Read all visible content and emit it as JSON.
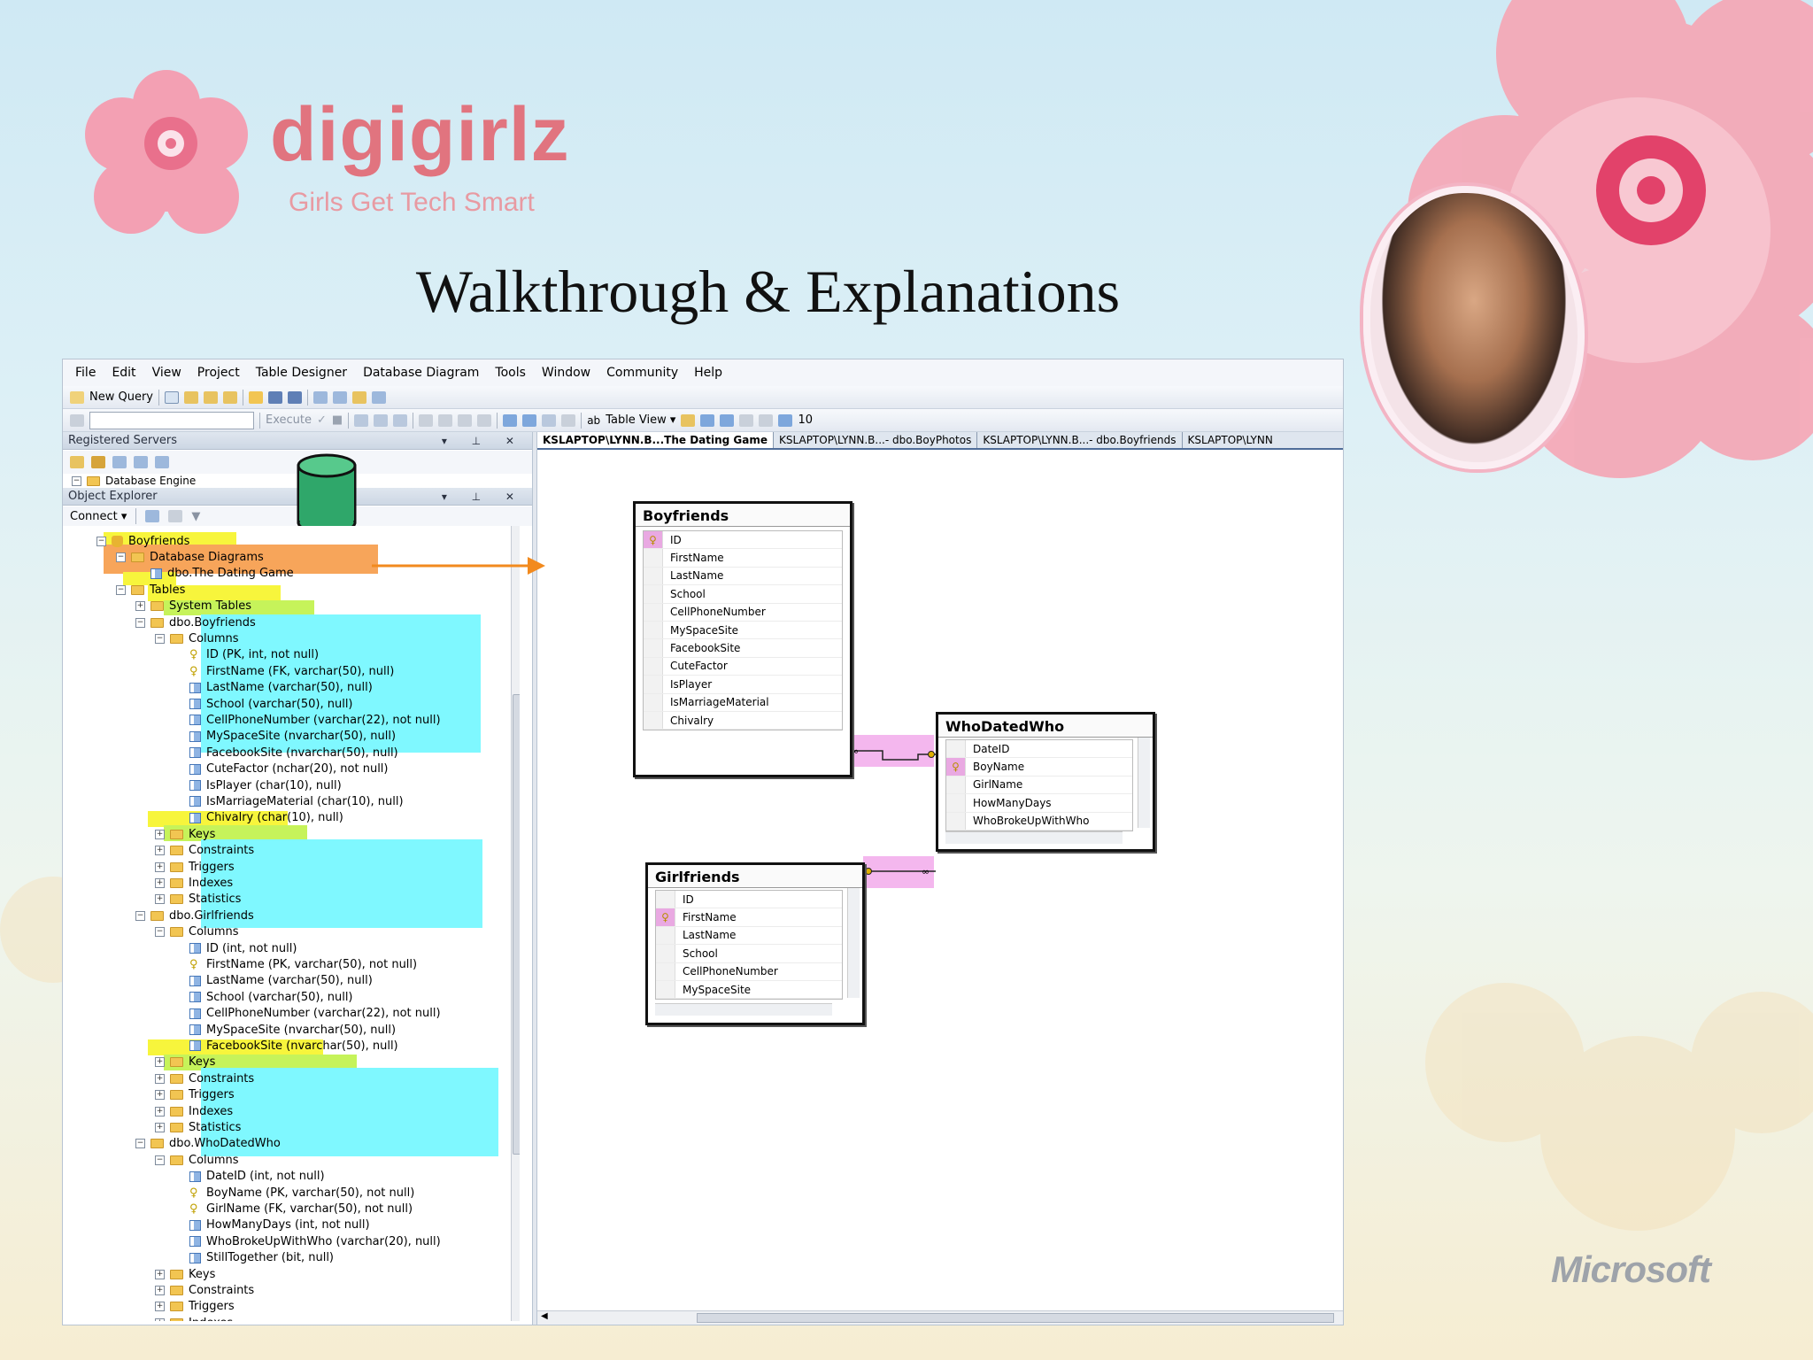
{
  "slide": {
    "brand_name": "digigirlz",
    "brand_tagline": "Girls Get Tech Smart",
    "title": "Walkthrough & Explanations",
    "footer_logo": "Microsoft"
  },
  "menu": [
    "File",
    "Edit",
    "View",
    "Project",
    "Table Designer",
    "Database Diagram",
    "Tools",
    "Window",
    "Community",
    "Help"
  ],
  "toolbar": {
    "new_query": "New Query",
    "execute": "Execute",
    "table_view": "Table View ▾",
    "zoom": "10"
  },
  "registered_servers": {
    "header": "Registered Servers",
    "item": "Database Engine"
  },
  "object_explorer": {
    "header": "Object Explorer",
    "connect": "Connect ▾",
    "nodes": [
      {
        "text": "Boyfriends",
        "icon": "database-icon",
        "exp": "−"
      },
      {
        "text": "Database Diagrams",
        "icon": "folder-icon",
        "exp": "−"
      },
      {
        "text": "dbo.The Dating Game",
        "icon": "diagram-icon",
        "exp": ""
      },
      {
        "text": "Tables",
        "icon": "folder-icon",
        "exp": "−"
      },
      {
        "text": "System Tables",
        "icon": "folder-icon",
        "exp": "+"
      },
      {
        "text": "dbo.Boyfriends",
        "icon": "table-icon",
        "exp": "−"
      },
      {
        "text": "Columns",
        "icon": "folder-icon",
        "exp": "−"
      },
      {
        "text": "ID (PK, int, not null)",
        "icon": "key-icon",
        "exp": ""
      },
      {
        "text": "FirstName (FK, varchar(50), null)",
        "icon": "key-icon",
        "exp": ""
      },
      {
        "text": "LastName (varchar(50), null)",
        "icon": "column-icon",
        "exp": ""
      },
      {
        "text": "School (varchar(50), null)",
        "icon": "column-icon",
        "exp": ""
      },
      {
        "text": "CellPhoneNumber (varchar(22), not null)",
        "icon": "column-icon",
        "exp": ""
      },
      {
        "text": "MySpaceSite (nvarchar(50), null)",
        "icon": "column-icon",
        "exp": ""
      },
      {
        "text": "FacebookSite (nvarchar(50), null)",
        "icon": "column-icon",
        "exp": ""
      },
      {
        "text": "CuteFactor (nchar(20), not null)",
        "icon": "column-icon",
        "exp": ""
      },
      {
        "text": "IsPlayer (char(10), null)",
        "icon": "column-icon",
        "exp": ""
      },
      {
        "text": "IsMarriageMaterial (char(10), null)",
        "icon": "column-icon",
        "exp": ""
      },
      {
        "text": "Chivalry (char(10), null)",
        "icon": "column-icon",
        "exp": ""
      },
      {
        "text": "Keys",
        "icon": "folder-icon",
        "exp": "+"
      },
      {
        "text": "Constraints",
        "icon": "folder-icon",
        "exp": "+"
      },
      {
        "text": "Triggers",
        "icon": "folder-icon",
        "exp": "+"
      },
      {
        "text": "Indexes",
        "icon": "folder-icon",
        "exp": "+"
      },
      {
        "text": "Statistics",
        "icon": "folder-icon",
        "exp": "+"
      },
      {
        "text": "dbo.Girlfriends",
        "icon": "table-icon",
        "exp": "−"
      },
      {
        "text": "Columns",
        "icon": "folder-icon",
        "exp": "−"
      },
      {
        "text": "ID (int, not null)",
        "icon": "column-icon",
        "exp": ""
      },
      {
        "text": "FirstName (PK, varchar(50), not null)",
        "icon": "key-icon",
        "exp": ""
      },
      {
        "text": "LastName (varchar(50), null)",
        "icon": "column-icon",
        "exp": ""
      },
      {
        "text": "School (varchar(50), null)",
        "icon": "column-icon",
        "exp": ""
      },
      {
        "text": "CellPhoneNumber (varchar(22), not null)",
        "icon": "column-icon",
        "exp": ""
      },
      {
        "text": "MySpaceSite (nvarchar(50), null)",
        "icon": "column-icon",
        "exp": ""
      },
      {
        "text": "FacebookSite (nvarchar(50), null)",
        "icon": "column-icon",
        "exp": ""
      },
      {
        "text": "Keys",
        "icon": "folder-icon",
        "exp": "+"
      },
      {
        "text": "Constraints",
        "icon": "folder-icon",
        "exp": "+"
      },
      {
        "text": "Triggers",
        "icon": "folder-icon",
        "exp": "+"
      },
      {
        "text": "Indexes",
        "icon": "folder-icon",
        "exp": "+"
      },
      {
        "text": "Statistics",
        "icon": "folder-icon",
        "exp": "+"
      },
      {
        "text": "dbo.WhoDatedWho",
        "icon": "table-icon",
        "exp": "−"
      },
      {
        "text": "Columns",
        "icon": "folder-icon",
        "exp": "−"
      },
      {
        "text": "DateID (int, not null)",
        "icon": "column-icon",
        "exp": ""
      },
      {
        "text": "BoyName (PK, varchar(50), not null)",
        "icon": "key-icon",
        "exp": ""
      },
      {
        "text": "GirlName (FK, varchar(50), not null)",
        "icon": "key-icon",
        "exp": ""
      },
      {
        "text": "HowManyDays (int, not null)",
        "icon": "column-icon",
        "exp": ""
      },
      {
        "text": "WhoBrokeUpWithWho (varchar(20), null)",
        "icon": "column-icon",
        "exp": ""
      },
      {
        "text": "StillTogether (bit, null)",
        "icon": "column-icon",
        "exp": ""
      },
      {
        "text": "Keys",
        "icon": "folder-icon",
        "exp": "+"
      },
      {
        "text": "Constraints",
        "icon": "folder-icon",
        "exp": "+"
      },
      {
        "text": "Triggers",
        "icon": "folder-icon",
        "exp": "+"
      },
      {
        "text": "Indexes",
        "icon": "folder-icon",
        "exp": "+"
      }
    ]
  },
  "doc_tabs": [
    "KSLAPTOP\\LYNN.B...The Dating Game",
    "KSLAPTOP\\LYNN.B...- dbo.BoyPhotos",
    "KSLAPTOP\\LYNN.B...- dbo.Boyfriends",
    "KSLAPTOP\\LYNN"
  ],
  "diagram": {
    "boyfriends": {
      "title": "Boyfriends",
      "columns": [
        "ID",
        "FirstName",
        "LastName",
        "School",
        "CellPhoneNumber",
        "MySpaceSite",
        "FacebookSite",
        "CuteFactor",
        "IsPlayer",
        "IsMarriageMaterial",
        "Chivalry"
      ]
    },
    "whodatedwho": {
      "title": "WhoDatedWho",
      "columns": [
        "DateID",
        "BoyName",
        "GirlName",
        "HowManyDays",
        "WhoBrokeUpWithWho"
      ]
    },
    "girlfriends": {
      "title": "Girlfriends",
      "columns": [
        "ID",
        "FirstName",
        "LastName",
        "School",
        "CellPhoneNumber",
        "MySpaceSite"
      ]
    }
  },
  "colors": {
    "highlight_yellow": "#f7f53c",
    "highlight_orange": "#f7a55a",
    "highlight_green": "#c6f35a",
    "highlight_cyan": "#7ff8ff",
    "relationship_pink": "#f4b7ee",
    "arrow": "#f28a1e",
    "brand_pink": "#e1747f"
  }
}
